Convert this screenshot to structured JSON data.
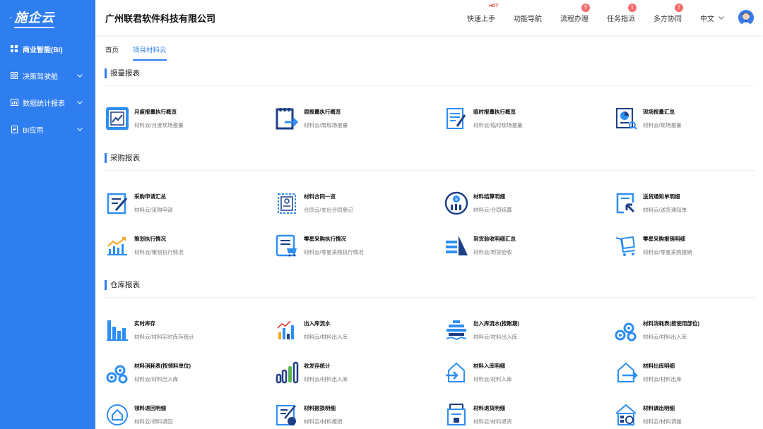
{
  "sidebar": {
    "logo_prefix": "·",
    "logo_text": "施企云",
    "items": [
      {
        "label": "商业智能(BI)",
        "icon": "grid-icon"
      },
      {
        "label": "决策驾驶舱",
        "icon": "dashboard-icon"
      },
      {
        "label": "数据统计报表",
        "icon": "report-icon"
      },
      {
        "label": "BI应用",
        "icon": "document-icon"
      }
    ]
  },
  "header": {
    "company": "广州联君软件科技有限公司",
    "nav": [
      {
        "label": "快速上手",
        "tag": "HOT"
      },
      {
        "label": "功能导航"
      },
      {
        "label": "流程办理",
        "badge": "9"
      },
      {
        "label": "任务指派",
        "badge": "1"
      },
      {
        "label": "多方协同",
        "badge": "1"
      }
    ],
    "language": "中文"
  },
  "tabs": [
    {
      "label": "首页"
    },
    {
      "label": "项目材料云"
    }
  ],
  "sections": [
    {
      "title": "报量报表",
      "cards": [
        {
          "name": "月度报量执行概览",
          "path": "材料云/月度现场报量",
          "icon": "monthly-report-icon"
        },
        {
          "name": "周报量执行概览",
          "path": "材料云/周现场报量",
          "icon": "weekly-report-icon"
        },
        {
          "name": "临时报量执行概览",
          "path": "材料云/临时现场报量",
          "icon": "temp-report-icon"
        },
        {
          "name": "现场报量汇总",
          "path": "材料云/现场报量",
          "icon": "site-summary-icon"
        }
      ]
    },
    {
      "title": "采购报表",
      "cards": [
        {
          "name": "采购申请汇总",
          "path": "材料云/采购申请",
          "icon": "purchase-request-icon"
        },
        {
          "name": "材料合同一览",
          "path": "合同云/支出合同登记",
          "icon": "contract-icon"
        },
        {
          "name": "材料结算明细",
          "path": "材料云/合同结算",
          "icon": "settlement-icon"
        },
        {
          "name": "送货通知单明细",
          "path": "材料云/送货通知单",
          "icon": "delivery-notice-icon"
        },
        {
          "name": "策划执行情况",
          "path": "材料云/策划执行情况",
          "icon": "plan-chart-icon"
        },
        {
          "name": "零星采购执行情况",
          "path": "材料云/零星采购执行情况",
          "icon": "sporadic-purchase-icon"
        },
        {
          "name": "到货验收明细汇总",
          "path": "材料云/到货验收",
          "icon": "arrival-check-icon"
        },
        {
          "name": "零星采购报销明细",
          "path": "材料云/零星采购报销",
          "icon": "reimburse-icon"
        }
      ]
    },
    {
      "title": "仓库报表",
      "cards": [
        {
          "name": "实时库存",
          "path": "材料云/材料实时库存统计",
          "icon": "bar-chart-icon"
        },
        {
          "name": "出入库流水",
          "path": "材料云/材料出入库",
          "icon": "inout-flow-icon"
        },
        {
          "name": "出入库流水(按账期)",
          "path": "材料云/材料出入库",
          "icon": "inout-period-icon"
        },
        {
          "name": "材料消耗表(按使用部位)",
          "path": "材料云/材料出入库",
          "icon": "pipes-icon"
        },
        {
          "name": "材料消耗表(按领料单位)",
          "path": "材料云/材料出入库",
          "icon": "pipes-icon"
        },
        {
          "name": "收发存统计",
          "path": "材料云/材料出入库",
          "icon": "stock-stats-icon"
        },
        {
          "name": "材料入库明细",
          "path": "材料云/材料入库",
          "icon": "warehouse-in-icon"
        },
        {
          "name": "材料出库明细",
          "path": "材料云/材料出库",
          "icon": "warehouse-out-icon"
        },
        {
          "name": "领料退回明细",
          "path": "材料云/领料退回",
          "icon": "return-icon"
        },
        {
          "name": "材料报损明细",
          "path": "材料云/材料报损",
          "icon": "loss-report-icon"
        },
        {
          "name": "材料退货明细",
          "path": "材料云/材料退货",
          "icon": "refund-icon"
        },
        {
          "name": "材料调出明细",
          "path": "材料云/材料调拨",
          "icon": "transfer-icon"
        }
      ]
    }
  ],
  "colors": {
    "primary": "#2f7ef0",
    "icon_dark": "#1d3f86",
    "icon_light": "#2d8ef5",
    "badge": "#f56c6c"
  }
}
